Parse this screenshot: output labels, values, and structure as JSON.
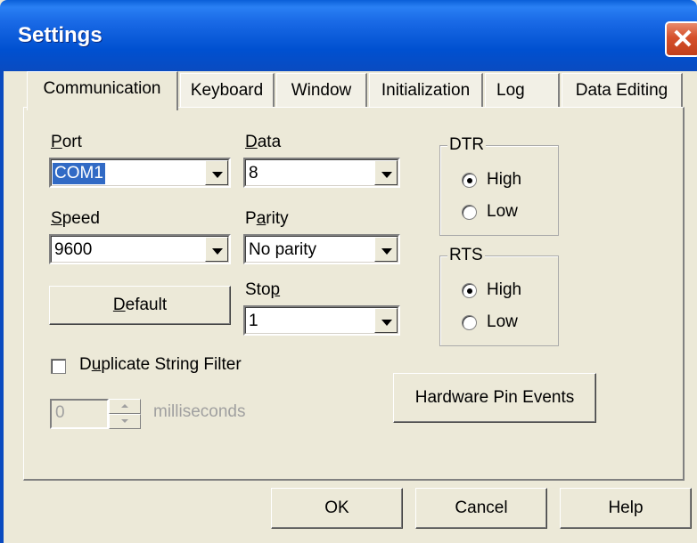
{
  "window": {
    "title": "Settings",
    "close_glyph": "✕"
  },
  "tabs": [
    {
      "label": "Communication",
      "active": true
    },
    {
      "label": "Keyboard",
      "active": false
    },
    {
      "label": "Window",
      "active": false
    },
    {
      "label": "Initialization",
      "active": false
    },
    {
      "label": "Log",
      "active": false
    },
    {
      "label": "Data Editing",
      "active": false
    }
  ],
  "port": {
    "mnemonic": "P",
    "rest": "ort",
    "value": "COM1"
  },
  "speed": {
    "mnemonic": "S",
    "rest": "peed",
    "value": "9600"
  },
  "data": {
    "mnemonic": "D",
    "rest": "ata",
    "value": "8"
  },
  "parity": {
    "pre": "P",
    "mnemonic": "a",
    "rest": "rity",
    "value": "No parity"
  },
  "stop": {
    "pre": "Sto",
    "mnemonic": "p",
    "value": "1"
  },
  "default_button": {
    "mnemonic": "D",
    "rest": "efault"
  },
  "dtr": {
    "legend": "DTR",
    "high": "High",
    "low": "Low",
    "selected": "High"
  },
  "rts": {
    "legend": "RTS",
    "high": "High",
    "low": "Low",
    "selected": "High"
  },
  "duplicate_filter": {
    "pre": "D",
    "mnemonic": "u",
    "rest": "plicate String Filter",
    "checked": false
  },
  "spinner": {
    "value": "0",
    "unit": "milliseconds"
  },
  "hardware_button": "Hardware Pin Events",
  "footer": {
    "ok": "OK",
    "cancel": "Cancel",
    "help": "Help"
  }
}
